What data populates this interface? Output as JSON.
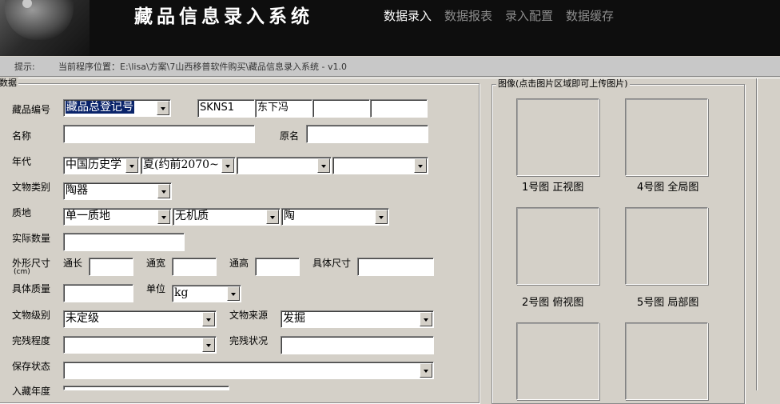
{
  "app": {
    "title": "藏品信息录入系统"
  },
  "nav": {
    "tabs": [
      "数据录入",
      "数据报表",
      "录入配置",
      "数据缓存"
    ]
  },
  "status": {
    "label": "提示:",
    "path": "当前程序位置：E:\\lisa\\方案\\7山西移普软件购买\\藏品信息录入系统 - v1.0"
  },
  "form": {
    "group_title": "数据",
    "labels": {
      "code": "藏品编号",
      "name": "名称",
      "orig_name": "原名",
      "era": "年代",
      "category": "文物类别",
      "texture": "质地",
      "qty": "实际数量",
      "dims": "外形尺寸",
      "dims_unit": "(cm)",
      "length": "通长",
      "width": "通宽",
      "height": "通高",
      "size_detail": "具体尺寸",
      "weight": "具体质量",
      "unit": "单位",
      "grade": "文物级别",
      "source": "文物来源",
      "completeness": "完残程度",
      "condition": "完残状况",
      "preservation": "保存状态",
      "entry_year": "入藏年度"
    },
    "values": {
      "code_type": "藏品总登记号",
      "code1": "SKNS1",
      "code2": "东下冯",
      "code3": "",
      "code4": "",
      "era1": "中国历史学",
      "era2": "夏(约前2070~",
      "era3": "",
      "era4": "",
      "category": "陶器",
      "texture1": "单一质地",
      "texture2": "无机质",
      "texture3": "陶",
      "unit": "kg",
      "grade": "未定级",
      "source": "发掘",
      "completeness": "",
      "preservation": ""
    }
  },
  "images": {
    "group_title": "图像(点击图片区域即可上传图片)",
    "captions": [
      "1号图 正视图",
      "4号图 全局图",
      "2号图 俯视图",
      "5号图 局部图"
    ]
  }
}
